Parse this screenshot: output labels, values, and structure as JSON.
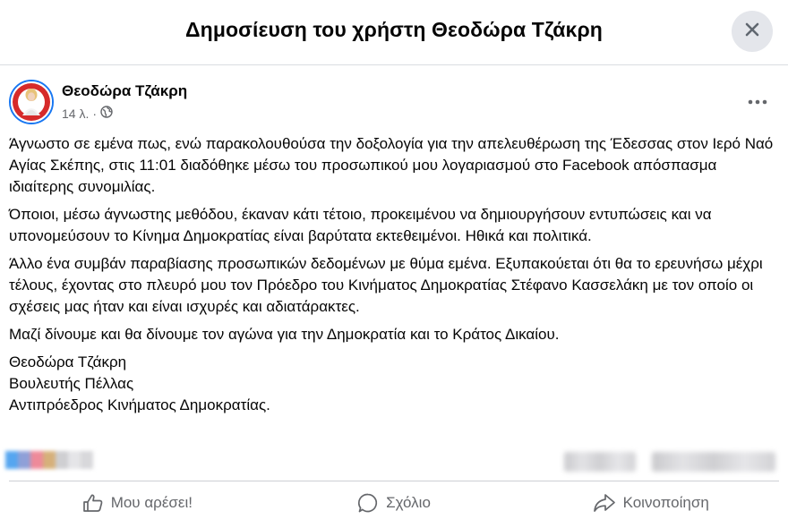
{
  "header": {
    "title": "Δημοσίευση του χρήστη Θεοδώρα Τζάκρη"
  },
  "post": {
    "author": "Θεοδώρα Τζάκρη",
    "time": "14 λ.",
    "separator": "·",
    "paragraphs": [
      "Άγνωστο σε εμένα πως, ενώ παρακολουθούσα την δοξολογία για την απελευθέρωση της Έδεσσας στον Ιερό Ναό Αγίας Σκέπης, στις 11:01 διαδόθηκε μέσω του προσωπικού μου λογαριασμού στο Facebook απόσπασμα ιδιαίτερης συνομιλίας.",
      "Όποιοι, μέσω άγνωστης μεθόδου, έκαναν κάτι τέτοιο, προκειμένου να δημιουργήσουν εντυπώσεις και να υπονομεύσουν το Κίνημα Δημοκρατίας είναι βαρύτατα εκτεθειμένοι. Ηθικά και πολιτικά.",
      "Άλλο ένα συμβάν παραβίασης προσωπικών δεδομένων με θύμα εμένα. Εξυπακούεται ότι θα το ερευνήσω μέχρι τέλους, έχοντας στο πλευρό μου τον Πρόεδρο του Κινήματος Δημοκρατίας Στέφανο Κασσελάκη με τον οποίο οι σχέσεις μας ήταν και είναι ισχυρές και αδιατάρακτες.",
      "Μαζί δίνουμε και θα δίνουμε τον αγώνα για την Δημοκρατία και το Κράτος Δικαίου."
    ],
    "signature": [
      "Θεοδώρα Τζάκρη",
      "Βουλευτής Πέλλας",
      "Αντιπρόεδρος Κινήματος Δημοκρατίας."
    ]
  },
  "actions": {
    "like": "Μου αρέσει!",
    "comment": "Σχόλιο",
    "share": "Κοινοποίηση"
  },
  "icons": {
    "close": "close-icon",
    "globe": "globe-icon",
    "more": "more-icon",
    "like": "thumbs-up-icon",
    "comment": "comment-icon",
    "share": "share-icon"
  },
  "colors": {
    "accent": "#1877f2",
    "text": "#050505",
    "secondary": "#65676b",
    "close_bg": "#e4e6eb",
    "divider": "#ced0d4"
  }
}
